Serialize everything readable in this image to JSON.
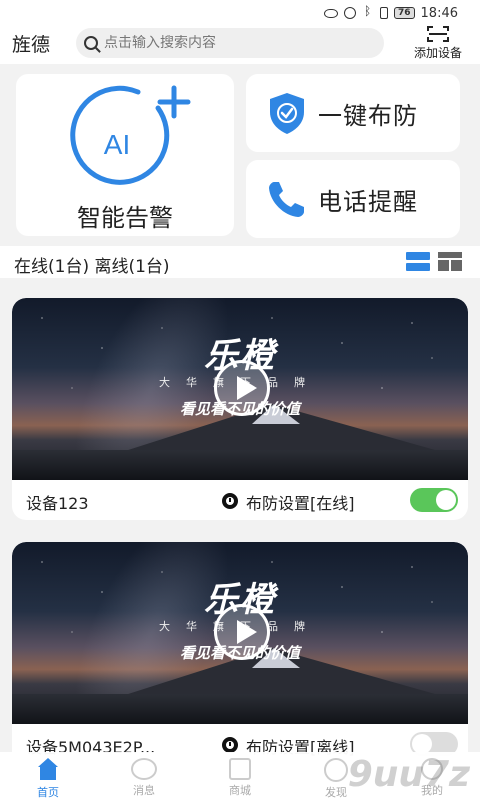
{
  "status_bar": {
    "time": "18:46",
    "battery": "76"
  },
  "header": {
    "brand": "旌德",
    "search_placeholder": "点击输入搜索内容",
    "add_device_label": "添加设备"
  },
  "quick_actions": {
    "ai_text": "AI",
    "ai_label": "智能告警",
    "arm_label": "一键布防",
    "phone_label": "电话提醒"
  },
  "summary": {
    "text": "在线(1台) 离线(1台)"
  },
  "devices": [
    {
      "name": "设备123",
      "status": "布防设置[在线]",
      "toggle_on": true,
      "thumbnail": {
        "logo": "乐橙",
        "sub": "大华旗下品牌",
        "slogan": "看见看不见的价值"
      }
    },
    {
      "name": "设备5M043E2P...",
      "status": "布防设置[离线]",
      "toggle_on": false,
      "thumbnail": {
        "logo": "乐橙",
        "sub": "大华旗下品牌",
        "slogan": "看见看不见的价值"
      }
    }
  ],
  "tabbar": {
    "items": [
      {
        "label": "首页",
        "icon": "home-icon",
        "active": true
      },
      {
        "label": "消息",
        "icon": "message-icon",
        "active": false
      },
      {
        "label": "商城",
        "icon": "shop-icon",
        "active": false
      },
      {
        "label": "发现",
        "icon": "discover-icon",
        "active": false
      },
      {
        "label": "我的",
        "icon": "profile-icon",
        "active": false
      }
    ]
  },
  "watermark": "9uu7z",
  "colors": {
    "accent": "#2f86e3",
    "toggle_on": "#5ac65a",
    "toggle_off": "#dddddd"
  }
}
